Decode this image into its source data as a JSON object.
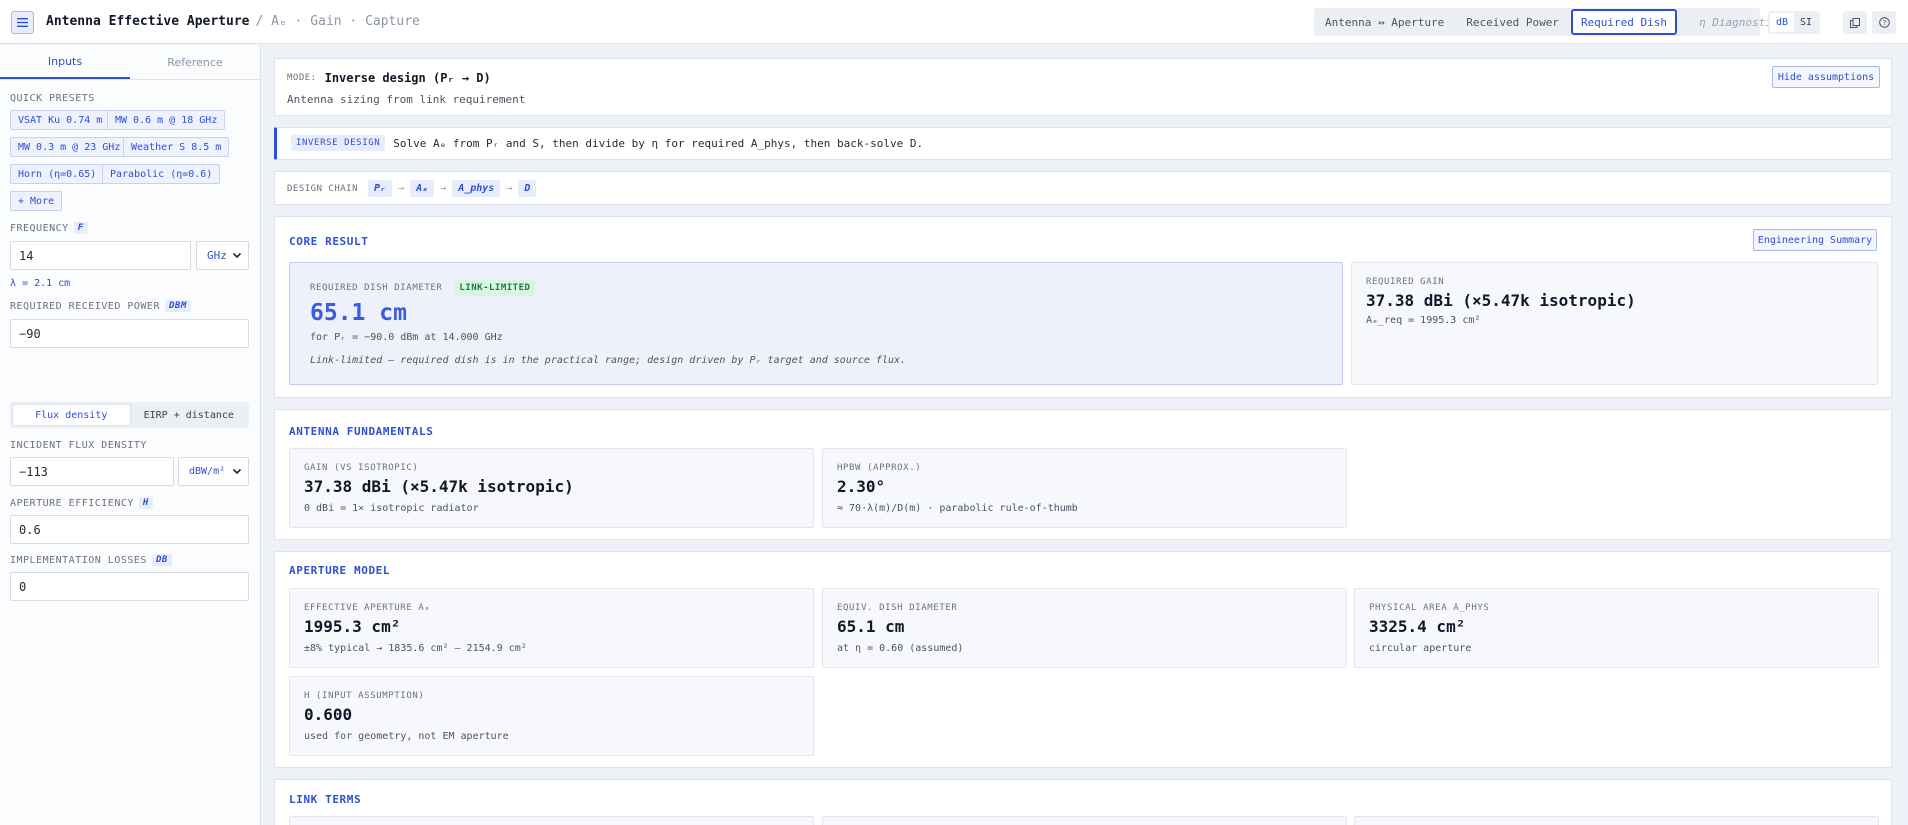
{
  "header": {
    "title": "Antenna Effective Aperture",
    "breadcrumb": "/ Aₑ · Gain · Capture",
    "modes": [
      {
        "label": "Antenna ↔ Aperture",
        "active": false
      },
      {
        "label": "Received Power",
        "active": false
      },
      {
        "label": "Required Dish",
        "active": true
      },
      {
        "label": "η Diagnostic",
        "active": false
      }
    ],
    "units": [
      {
        "label": "dB",
        "active": true
      },
      {
        "label": "SI",
        "active": false
      }
    ],
    "icons": [
      "menu-icon",
      "copy-icon",
      "help-icon"
    ]
  },
  "sidebar": {
    "tabs": [
      {
        "label": "Inputs",
        "active": true
      },
      {
        "label": "Reference",
        "active": false
      }
    ],
    "presets_label": "QUICK PRESETS",
    "presets": [
      "VSAT Ku 0.74 m",
      "MW 0.6 m @ 18 GHz",
      "MW 0.3 m @ 23 GHz",
      "Weather S 8.5 m",
      "Horn (η=0.65)",
      "Parabolic (η=0.6)",
      "+ More"
    ],
    "frequency": {
      "label": "FREQUENCY",
      "symbol": "F",
      "value": "14",
      "unit": "GHz",
      "hint": "λ = 2.1 cm"
    },
    "received_power": {
      "label": "REQUIRED RECEIVED POWER",
      "symbol": "DBM",
      "value": "−90"
    },
    "source_mode": [
      {
        "label": "Flux density",
        "active": true
      },
      {
        "label": "EIRP + distance",
        "active": false
      }
    ],
    "flux": {
      "label": "INCIDENT FLUX DENSITY",
      "value": "−113",
      "unit": "dBW/m²"
    },
    "efficiency": {
      "label": "APERTURE EFFICIENCY",
      "symbol": "Η",
      "value": "0.6"
    },
    "losses": {
      "label": "IMPLEMENTATION LOSSES",
      "symbol": "DB",
      "value": "0"
    }
  },
  "mode_panel": {
    "mode_label": "MODE:",
    "mode_value": "Inverse design (Pᵣ → D)",
    "subtitle": "Antenna sizing from link requirement",
    "hide_button": "Hide assumptions"
  },
  "info_banner": {
    "tag": "INVERSE DESIGN",
    "text": "Solve Aₑ from Pᵣ and S, then divide by η for required A_phys, then back-solve D."
  },
  "design_chain": {
    "label": "DESIGN CHAIN",
    "steps": [
      "Pᵣ",
      "Aₑ",
      "A_phys",
      "D"
    ],
    "arrow": "→"
  },
  "core_result": {
    "title": "CORE RESULT",
    "summary_button": "Engineering Summary",
    "primary": {
      "label": "REQUIRED DISH DIAMETER",
      "badge": "LINK-LIMITED",
      "value": "65.1 cm",
      "sub": "for Pᵣ = −90.0 dBm at 14.000 GHz",
      "note": "Link-limited — required dish is in the practical range; design driven by Pᵣ target and source flux."
    },
    "secondary": {
      "label": "REQUIRED GAIN",
      "value": "37.38 dBi (×5.47k isotropic)",
      "sub": "Aₑ_req = 1995.3 cm²"
    }
  },
  "fundamentals": {
    "title": "ANTENNA FUNDAMENTALS",
    "cards": [
      {
        "label": "GAIN (VS ISOTROPIC)",
        "value": "37.38 dBi (×5.47k isotropic)",
        "sub": "0 dBi = 1× isotropic radiator"
      },
      {
        "label": "HPBW (APPROX.)",
        "value": "2.30°",
        "sub": "≈ 70·λ(m)/D(m) · parabolic rule-of-thumb"
      }
    ]
  },
  "aperture_model": {
    "title": "APERTURE MODEL",
    "cards": [
      {
        "label": "EFFECTIVE APERTURE Aₑ",
        "value": "1995.3 cm²",
        "sub": "±8% typical → 1835.6 cm² – 2154.9 cm²"
      },
      {
        "label": "EQUIV. DISH DIAMETER",
        "value": "65.1 cm",
        "sub": "at η = 0.60 (assumed)"
      },
      {
        "label": "PHYSICAL AREA A_PHYS",
        "value": "3325.4 cm²",
        "sub": "circular aperture"
      },
      {
        "label": "Η (INPUT ASSUMPTION)",
        "value": "0.600",
        "sub": "used for geometry, not EM aperture"
      }
    ]
  },
  "link_terms": {
    "title": "LINK TERMS"
  },
  "colors": {
    "accent": "#2f4fd6",
    "badge_bg": "#d7f5e3",
    "badge_text": "#1f7a45",
    "background": "#eef1f7"
  }
}
